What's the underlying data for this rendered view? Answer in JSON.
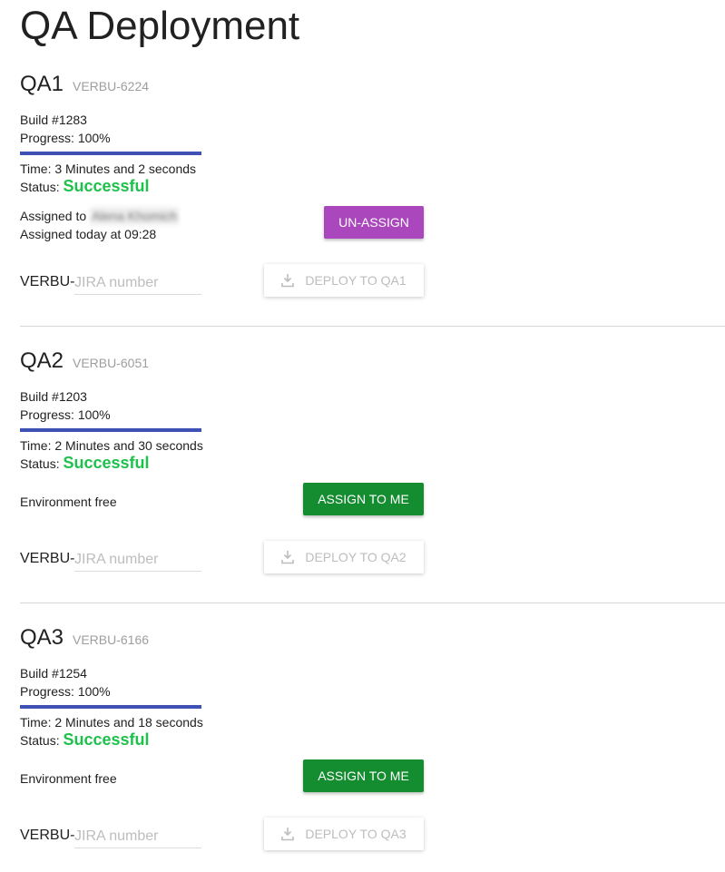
{
  "page_title": "QA Deployment",
  "labels": {
    "build_prefix": "Build #",
    "progress_prefix": "Progress: ",
    "time_prefix": "Time: ",
    "status_prefix": "Status: ",
    "assigned_to_prefix": "Assigned to ",
    "jira_prefix": "VERBU-",
    "jira_placeholder": "JIRA number"
  },
  "colors": {
    "status_success": "#1ec14b",
    "progress_bar": "#3f51b5",
    "unassign_button": "#ab47bc",
    "assign_button": "#138d2f"
  },
  "environments": [
    {
      "name": "QA1",
      "ticket": "VERBU-6224",
      "build": "1283",
      "progress": "100%",
      "progress_fraction": 1.0,
      "time": "3 Minutes and 2 seconds",
      "status": "Successful",
      "assigned_to": "Alena Khomich",
      "assigned_when": "Assigned today at 09:28",
      "assignment_state": "",
      "action_button": "UN-ASSIGN",
      "deploy_button": "DEPLOY TO QA1",
      "deploy_icon": "download-icon"
    },
    {
      "name": "QA2",
      "ticket": "VERBU-6051",
      "build": "1203",
      "progress": "100%",
      "progress_fraction": 1.0,
      "time": "2 Minutes and 30 seconds",
      "status": "Successful",
      "assignment_state": "Environment free",
      "action_button": "ASSIGN TO ME",
      "deploy_button": "DEPLOY TO QA2",
      "deploy_icon": "download-icon"
    },
    {
      "name": "QA3",
      "ticket": "VERBU-6166",
      "build": "1254",
      "progress": "100%",
      "progress_fraction": 1.0,
      "time": "2 Minutes and 18 seconds",
      "status": "Successful",
      "assignment_state": "Environment free",
      "action_button": "ASSIGN TO ME",
      "deploy_button": "DEPLOY TO QA3",
      "deploy_icon": "download-icon"
    }
  ]
}
